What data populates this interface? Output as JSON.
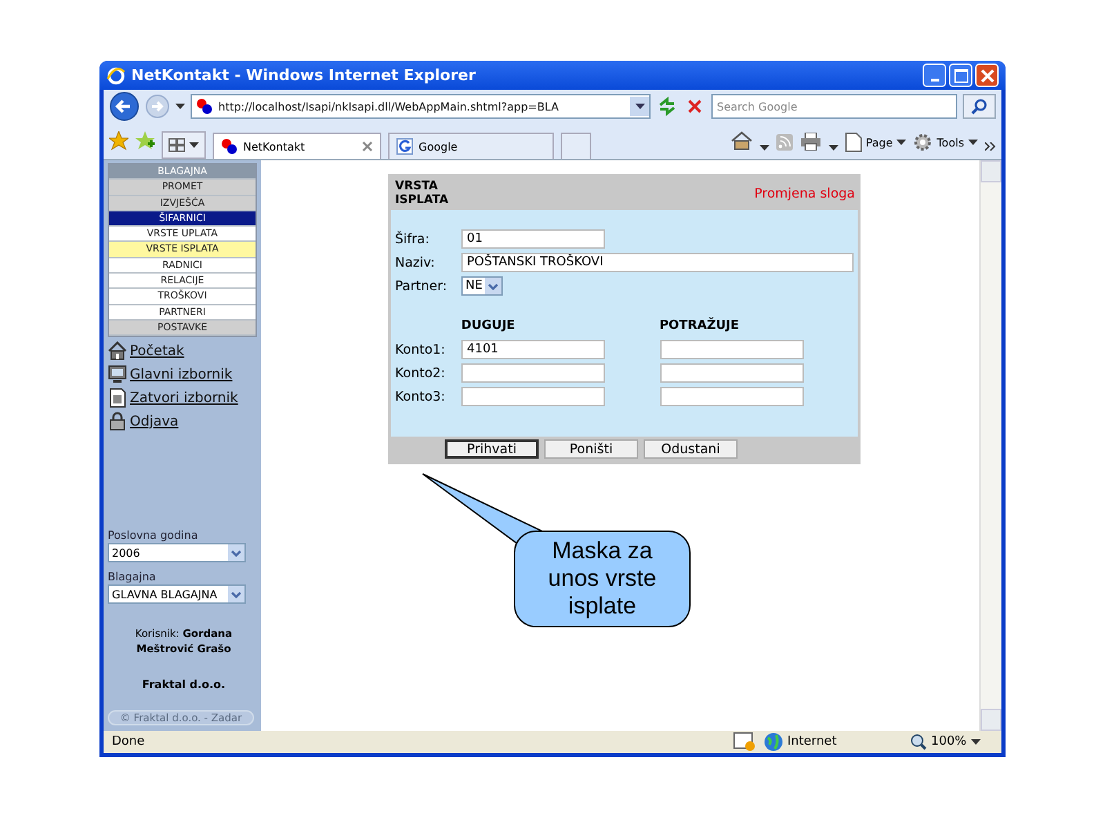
{
  "window": {
    "title": "NetKontakt - Windows Internet Explorer"
  },
  "address_bar": {
    "url": "http://localhost/Isapi/nkIsapi.dll/WebAppMain.shtml?app=BLA",
    "search_placeholder": "Search Google"
  },
  "tabs": [
    {
      "label": "NetKontakt",
      "selected": true
    },
    {
      "label": "Google",
      "selected": false
    }
  ],
  "command_bar": {
    "page": "Page",
    "tools": "Tools"
  },
  "sidebar": {
    "menu": [
      {
        "label": "BLAGAJNA",
        "kind": "header"
      },
      {
        "label": "PROMET",
        "kind": "section",
        "selected": false
      },
      {
        "label": "IZVJEŠĆA",
        "kind": "section",
        "selected": false
      },
      {
        "label": "ŠIFARNICI",
        "kind": "section",
        "selected": true,
        "children": [
          {
            "label": "VRSTE UPLATA",
            "selected": false
          },
          {
            "label": "VRSTE ISPLATA",
            "selected": true
          },
          {
            "label": "RADNICI",
            "selected": false
          },
          {
            "label": "RELACIJE",
            "selected": false
          },
          {
            "label": "TROŠKOVI",
            "selected": false
          },
          {
            "label": "PARTNERI",
            "selected": false
          }
        ]
      },
      {
        "label": "POSTAVKE",
        "kind": "section",
        "selected": false
      }
    ],
    "links": [
      {
        "label": "Početak"
      },
      {
        "label": "Glavni izbornik"
      },
      {
        "label": "Zatvori izbornik"
      },
      {
        "label": "Odjava"
      }
    ],
    "selects": [
      {
        "label": "Poslovna godina",
        "value": "2006"
      },
      {
        "label": "Blagajna",
        "value": "GLAVNA BLAGAJNA"
      }
    ],
    "user": "Korisnik: **Gordana Meštrović Grašo**",
    "company": "Fraktal d.o.o.",
    "copyright": "© Fraktal d.o.o. - Zadar"
  },
  "form": {
    "title": "VRSTA ISPLATA",
    "mode": "Promjena sloga",
    "fields": [
      {
        "label": "Šifra:",
        "value": "01",
        "kind": "short"
      },
      {
        "label": "Naziv:",
        "value": "POŠTANSKI TROŠKOVI",
        "kind": "long"
      },
      {
        "label": "Partner:",
        "value": "NE",
        "kind": "select"
      }
    ],
    "columns": [
      "DUGUJE",
      "POTRAŽUJE"
    ],
    "konto": [
      {
        "label": "Konto1:",
        "duguje": "4101"
      },
      {
        "label": "Konto2:"
      },
      {
        "label": "Konto3:"
      }
    ],
    "buttons": [
      {
        "label": "Prihvati",
        "focused": true
      },
      {
        "label": "Poništi",
        "focused": false
      },
      {
        "label": "Odustani",
        "focused": false
      }
    ]
  },
  "callout": "Maska za unos vrste isplate",
  "status_bar": {
    "text": "Done",
    "zone": "Internet",
    "zoom": "100%"
  }
}
